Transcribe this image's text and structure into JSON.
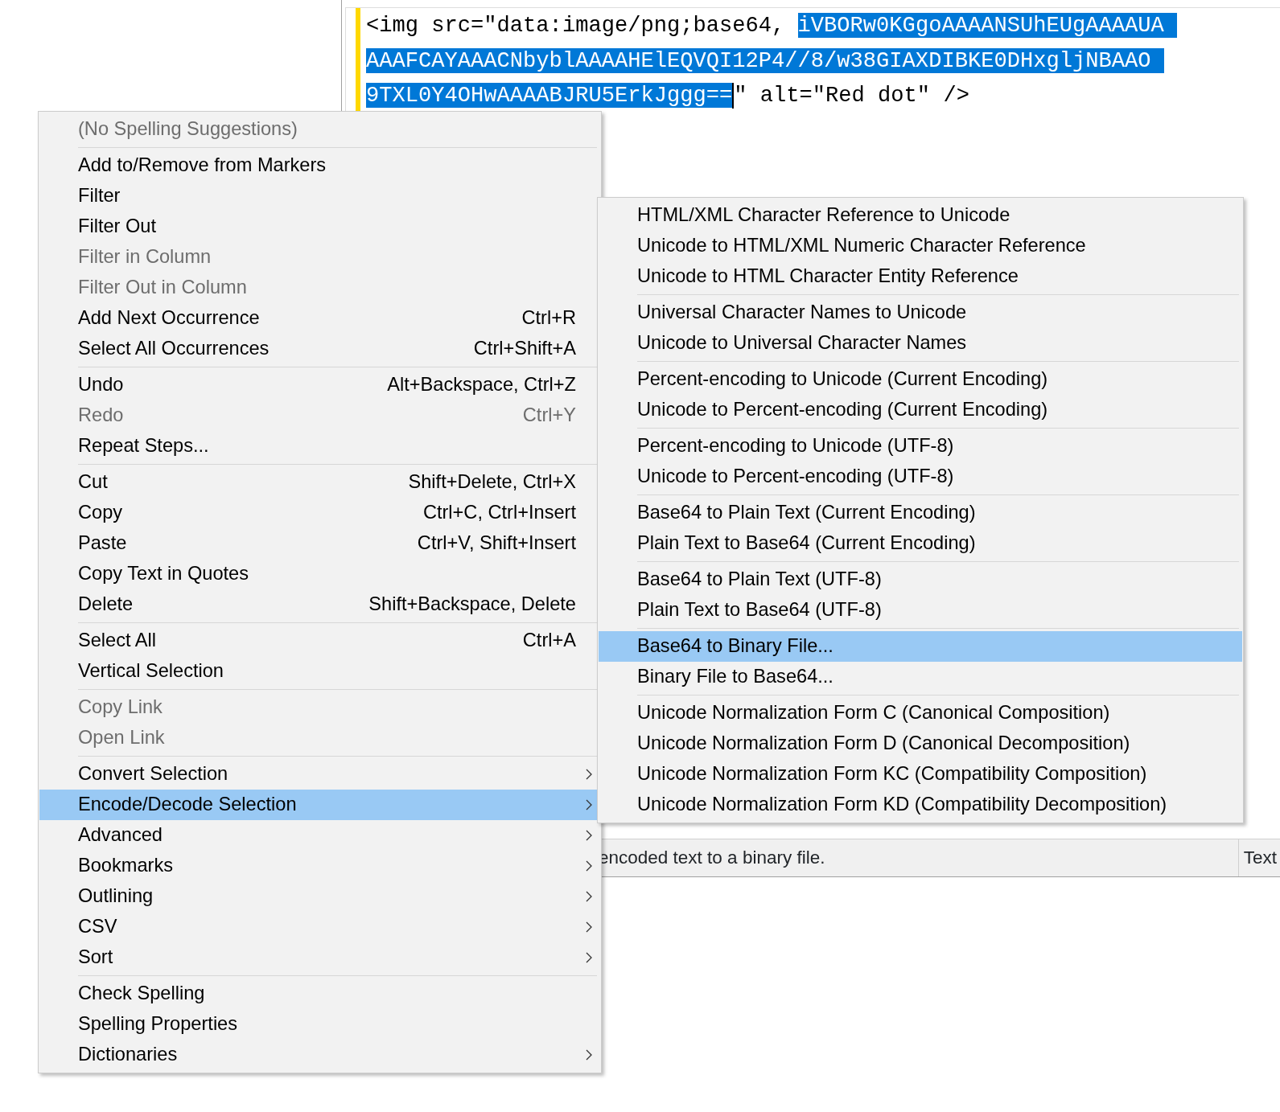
{
  "editor": {
    "lines": [
      {
        "segments": [
          {
            "text": "<img src=\"data:image/png;base64, ",
            "selected": false
          },
          {
            "text": "iVBORw0KGgoAAAANSUhEUgAAAAUA",
            "selected": true
          }
        ]
      },
      {
        "segments": [
          {
            "text": "AAAFCAYAAACNbyblAAAAHElEQVQI12P4//8/w38GIAXDIBKE0DHxgljNBAAO",
            "selected": true
          }
        ]
      },
      {
        "segments": [
          {
            "text": "9TXL0Y4OHwAAAABJRU5ErkJggg==",
            "selected": true
          },
          {
            "text": "\" alt=\"Red dot\" />",
            "selected": false
          }
        ]
      }
    ]
  },
  "status_bar": {
    "message": "encoded text to a binary file.",
    "mode": "Text"
  },
  "context_menu": {
    "groups": [
      [
        {
          "label": "(No Spelling Suggestions)",
          "disabled": true,
          "selected": false
        }
      ],
      [
        {
          "label": "Add to/Remove from Markers",
          "disabled": false,
          "selected": false
        },
        {
          "label": "Filter",
          "disabled": false,
          "selected": false
        },
        {
          "label": "Filter Out",
          "disabled": false,
          "selected": false
        },
        {
          "label": "Filter in Column",
          "disabled": true,
          "selected": false
        },
        {
          "label": "Filter Out in Column",
          "disabled": true,
          "selected": false
        },
        {
          "label": "Add Next Occurrence",
          "shortcut": "Ctrl+R",
          "disabled": false,
          "selected": false
        },
        {
          "label": "Select All Occurrences",
          "shortcut": "Ctrl+Shift+A",
          "disabled": false,
          "selected": false
        }
      ],
      [
        {
          "label": "Undo",
          "shortcut": "Alt+Backspace, Ctrl+Z",
          "disabled": false,
          "selected": false
        },
        {
          "label": "Redo",
          "shortcut": "Ctrl+Y",
          "disabled": true,
          "selected": false
        },
        {
          "label": "Repeat Steps...",
          "disabled": false,
          "selected": false
        }
      ],
      [
        {
          "label": "Cut",
          "shortcut": "Shift+Delete, Ctrl+X",
          "disabled": false,
          "selected": false
        },
        {
          "label": "Copy",
          "shortcut": "Ctrl+C, Ctrl+Insert",
          "disabled": false,
          "selected": false
        },
        {
          "label": "Paste",
          "shortcut": "Ctrl+V, Shift+Insert",
          "disabled": false,
          "selected": false
        },
        {
          "label": "Copy Text in Quotes",
          "disabled": false,
          "selected": false
        },
        {
          "label": "Delete",
          "shortcut": "Shift+Backspace, Delete",
          "disabled": false,
          "selected": false
        }
      ],
      [
        {
          "label": "Select All",
          "shortcut": "Ctrl+A",
          "disabled": false,
          "selected": false
        },
        {
          "label": "Vertical Selection",
          "disabled": false,
          "selected": false
        }
      ],
      [
        {
          "label": "Copy Link",
          "disabled": true,
          "selected": false
        },
        {
          "label": "Open Link",
          "disabled": true,
          "selected": false
        }
      ],
      [
        {
          "label": "Convert Selection",
          "submenu": true,
          "disabled": false,
          "selected": false
        },
        {
          "label": "Encode/Decode Selection",
          "submenu": true,
          "disabled": false,
          "selected": true
        },
        {
          "label": "Advanced",
          "submenu": true,
          "disabled": false,
          "selected": false
        },
        {
          "label": "Bookmarks",
          "submenu": true,
          "disabled": false,
          "selected": false
        },
        {
          "label": "Outlining",
          "submenu": true,
          "disabled": false,
          "selected": false
        },
        {
          "label": "CSV",
          "submenu": true,
          "disabled": false,
          "selected": false
        },
        {
          "label": "Sort",
          "submenu": true,
          "disabled": false,
          "selected": false
        }
      ],
      [
        {
          "label": "Check Spelling",
          "disabled": false,
          "selected": false
        },
        {
          "label": "Spelling Properties",
          "disabled": false,
          "selected": false
        },
        {
          "label": "Dictionaries",
          "submenu": true,
          "disabled": false,
          "selected": false
        }
      ]
    ]
  },
  "submenu": {
    "groups": [
      [
        {
          "label": "HTML/XML Character Reference to Unicode",
          "selected": false
        },
        {
          "label": "Unicode to HTML/XML Numeric Character Reference",
          "selected": false
        },
        {
          "label": "Unicode to HTML Character Entity Reference",
          "selected": false
        }
      ],
      [
        {
          "label": "Universal Character Names to Unicode",
          "selected": false
        },
        {
          "label": "Unicode to Universal Character Names",
          "selected": false
        }
      ],
      [
        {
          "label": "Percent-encoding to Unicode (Current Encoding)",
          "selected": false
        },
        {
          "label": "Unicode to Percent-encoding (Current Encoding)",
          "selected": false
        }
      ],
      [
        {
          "label": "Percent-encoding to Unicode (UTF-8)",
          "selected": false
        },
        {
          "label": "Unicode to Percent-encoding (UTF-8)",
          "selected": false
        }
      ],
      [
        {
          "label": "Base64 to Plain Text (Current Encoding)",
          "selected": false
        },
        {
          "label": "Plain Text to Base64 (Current Encoding)",
          "selected": false
        }
      ],
      [
        {
          "label": "Base64 to Plain Text (UTF-8)",
          "selected": false
        },
        {
          "label": "Plain Text to Base64 (UTF-8)",
          "selected": false
        }
      ],
      [
        {
          "label": "Base64 to Binary File...",
          "selected": true
        },
        {
          "label": "Binary File to Base64...",
          "selected": false
        }
      ],
      [
        {
          "label": "Unicode Normalization Form C (Canonical Composition)",
          "selected": false
        },
        {
          "label": "Unicode Normalization Form D (Canonical Decomposition)",
          "selected": false
        },
        {
          "label": "Unicode Normalization Form KC (Compatibility Composition)",
          "selected": false
        },
        {
          "label": "Unicode Normalization Form KD (Compatibility Decomposition)",
          "selected": false
        }
      ]
    ]
  }
}
